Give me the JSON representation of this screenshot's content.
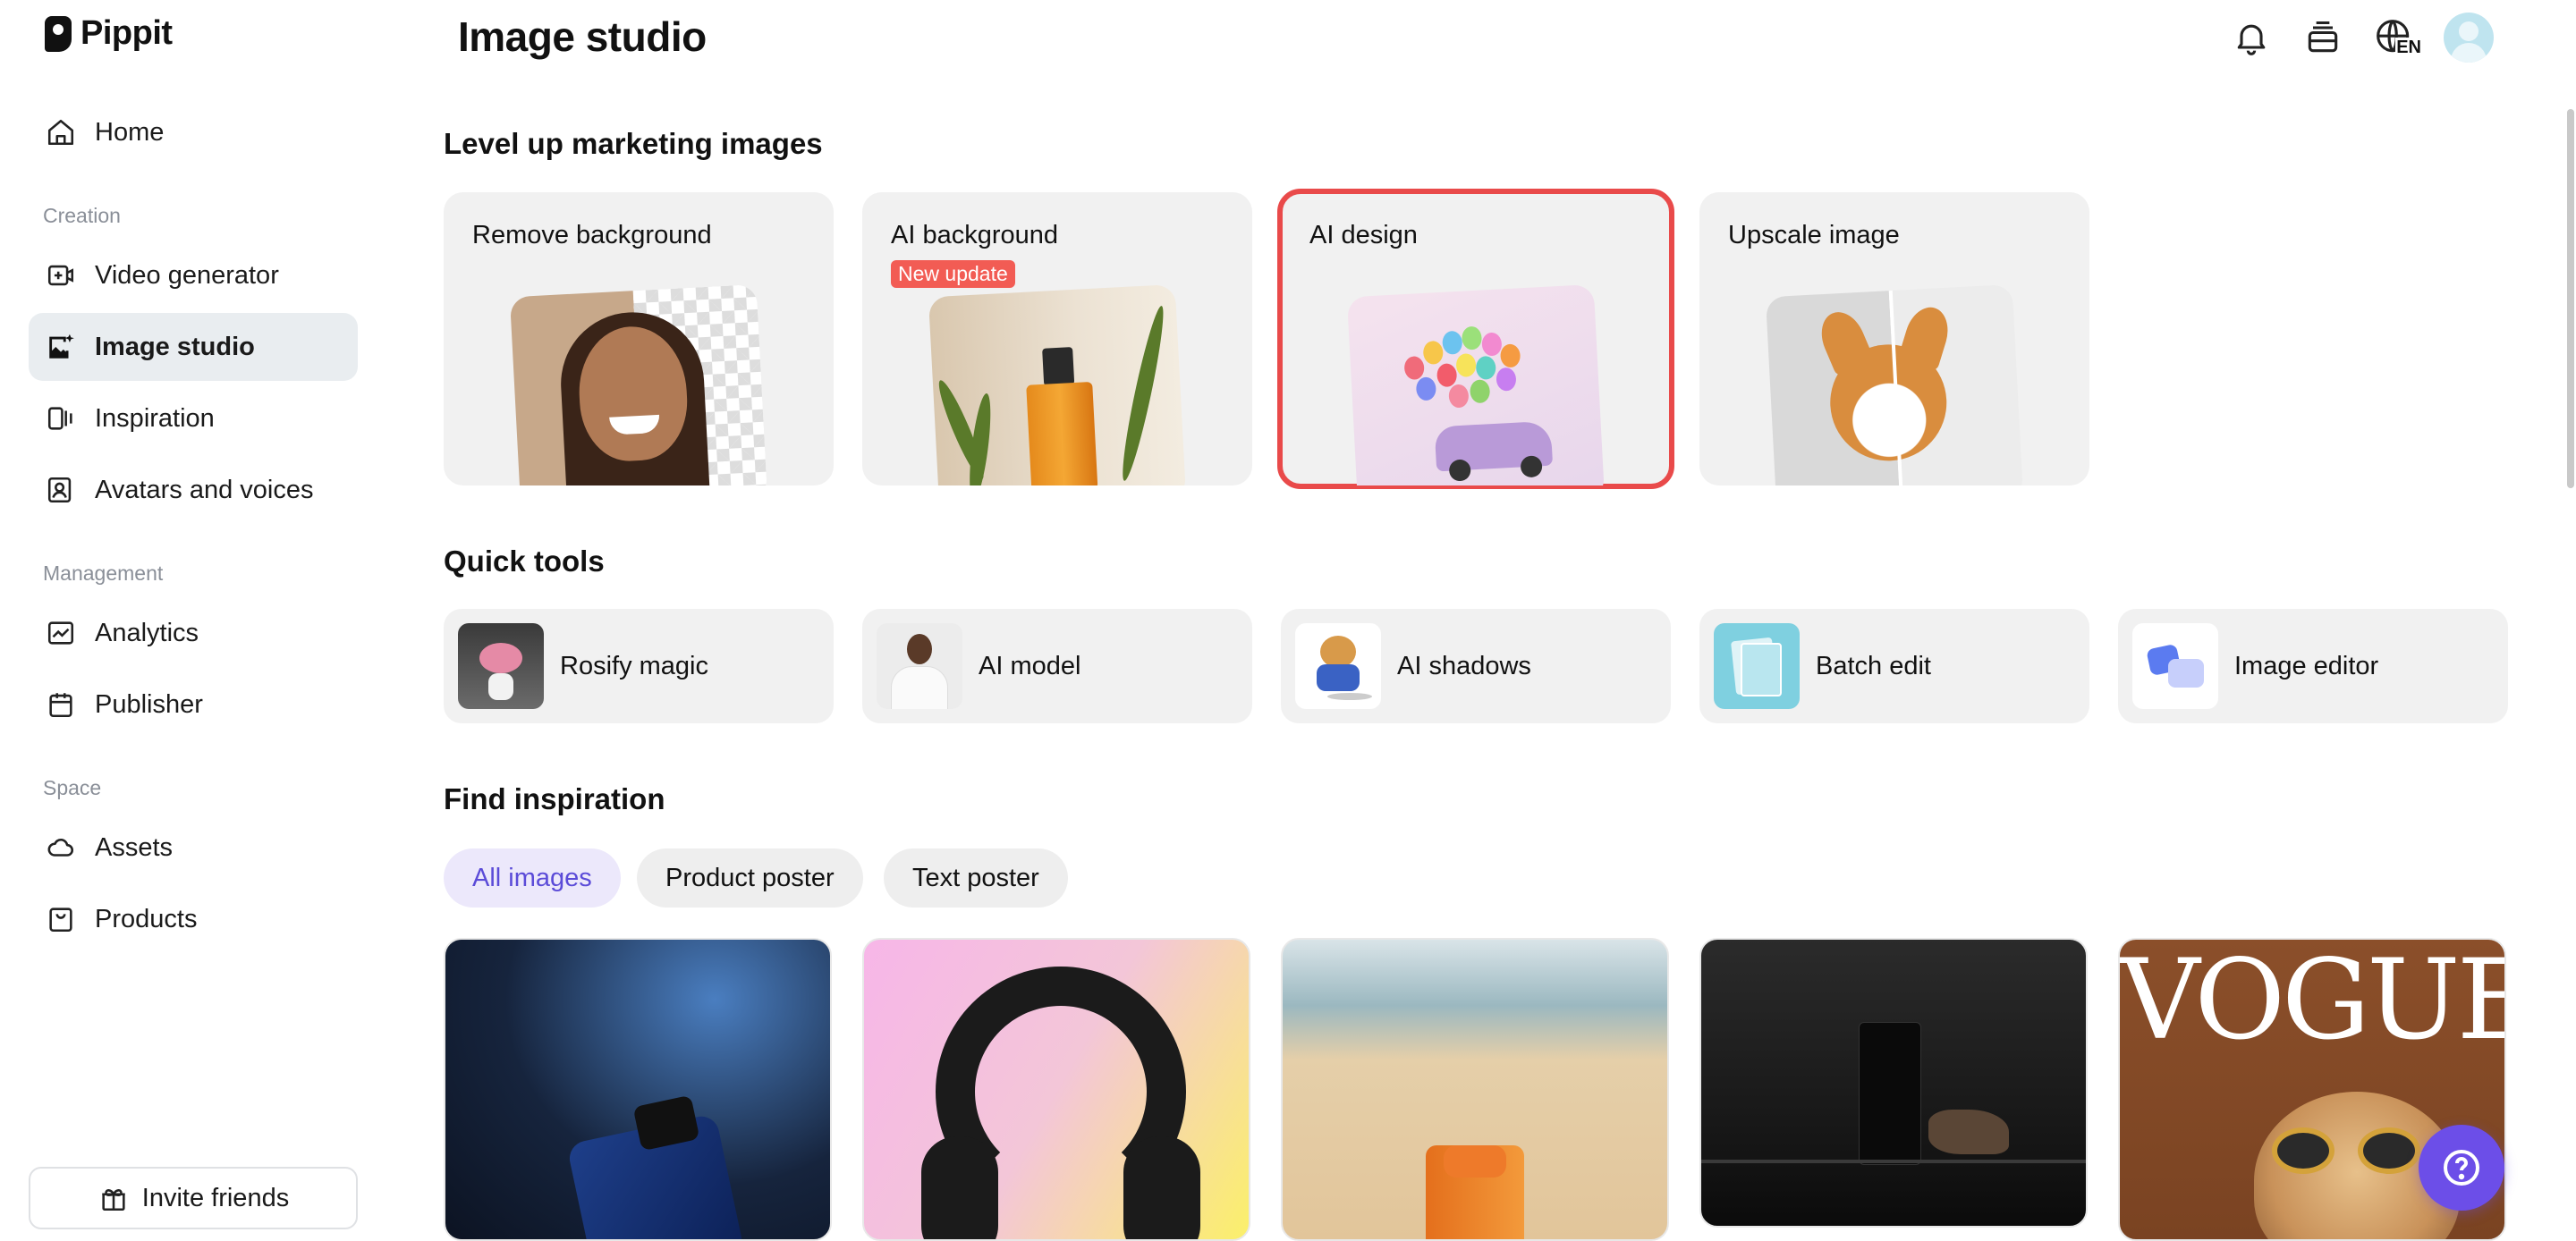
{
  "app": {
    "name": "Pippit"
  },
  "sidebar": {
    "home": "Home",
    "sections": {
      "creation": "Creation",
      "management": "Management",
      "space": "Space"
    },
    "items": {
      "video_generator": "Video generator",
      "image_studio": "Image studio",
      "inspiration": "Inspiration",
      "avatars_voices": "Avatars and voices",
      "analytics": "Analytics",
      "publisher": "Publisher",
      "assets": "Assets",
      "products": "Products"
    },
    "active_item": "Image studio",
    "invite": "Invite friends"
  },
  "header": {
    "title": "Image studio",
    "language": "EN",
    "icons": [
      "bell-icon",
      "stack-icon",
      "globe-icon",
      "avatar"
    ]
  },
  "sections": {
    "marketing": "Level up marketing images",
    "quick_tools": "Quick tools",
    "find_inspiration": "Find inspiration"
  },
  "feature_cards": {
    "remove_bg": "Remove background",
    "ai_bg": "AI background",
    "ai_bg_badge": "New update",
    "ai_design": "AI design",
    "upscale": "Upscale image"
  },
  "selected_card": "AI design",
  "quick_tools": {
    "rosify": "Rosify magic",
    "ai_model": "AI model",
    "ai_shadows": "AI shadows",
    "batch_edit": "Batch edit",
    "image_editor": "Image editor"
  },
  "filters": {
    "all": "All images",
    "product_poster": "Product poster",
    "text_poster": "Text poster",
    "active": "All images"
  },
  "inspiration": {
    "vogue_title": "VOGUE"
  },
  "colors": {
    "accent": "#6c4ee8",
    "selected_outline": "#e94a4a",
    "badge": "#f25c54",
    "active_nav": "#e9edf0"
  }
}
